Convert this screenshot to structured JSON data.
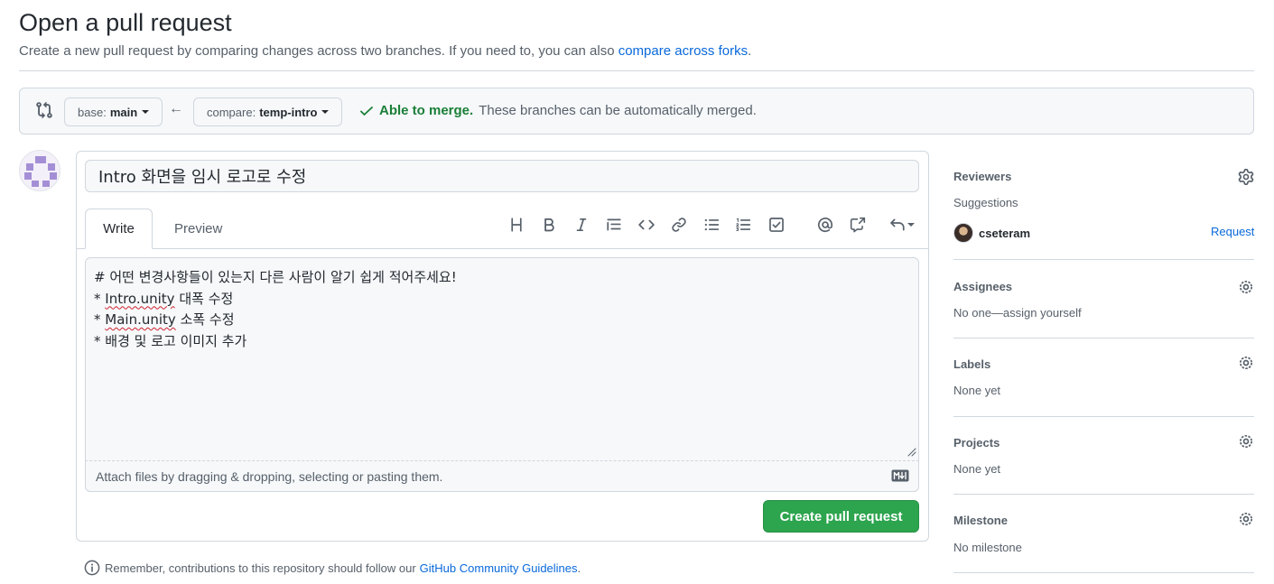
{
  "header": {
    "title": "Open a pull request",
    "description": "Create a new pull request by comparing changes across two branches. If you need to, you can also",
    "forks_link": "compare across forks",
    "period": "."
  },
  "compare": {
    "base_prefix": "base:",
    "base_branch": "main",
    "compare_prefix": "compare:",
    "compare_branch": "temp-intro",
    "arrow": "←",
    "merge_ok": "Able to merge.",
    "merge_text": "These branches can be automatically merged."
  },
  "form": {
    "title_value": "Intro 화면을 임시 로고로 수정",
    "tabs": {
      "write": "Write",
      "preview": "Preview"
    },
    "toolbar_icons": [
      "heading-icon",
      "bold-icon",
      "italic-icon",
      "quote-icon",
      "code-icon",
      "link-icon",
      "bulleted-list-icon",
      "numbered-list-icon",
      "task-list-icon",
      "mention-icon",
      "cross-reference-icon",
      "undo-icon"
    ],
    "body": {
      "line1": "# 어떤 변경사항들이 있는지 다른 사람이 알기 쉽게 적어주세요!",
      "line2_prefix": "* ",
      "line2_word": "Intro.unity",
      "line2_rest": " 대폭 수정",
      "line3_prefix": "* ",
      "line3_word": "Main.unity",
      "line3_rest": " 소폭 수정",
      "line4": "* 배경 및 로고 이미지 추가"
    },
    "attach_text": "Attach files by dragging & dropping, selecting or pasting them.",
    "submit_label": "Create pull request"
  },
  "footer": {
    "note": "Remember, contributions to this repository should follow our",
    "link": "GitHub Community Guidelines",
    "period": "."
  },
  "sidebar": {
    "reviewers": {
      "title": "Reviewers",
      "sub": "Suggestions",
      "user": "cseteram",
      "action": "Request"
    },
    "assignees": {
      "title": "Assignees",
      "value": "No one—assign yourself"
    },
    "labels": {
      "title": "Labels",
      "value": "None yet"
    },
    "projects": {
      "title": "Projects",
      "value": "None yet"
    },
    "milestone": {
      "title": "Milestone",
      "value": "No milestone"
    }
  },
  "colors": {
    "accent": "#0969da",
    "success": "#1a7f37",
    "button": "#2da44e",
    "border": "#d0d7de"
  }
}
